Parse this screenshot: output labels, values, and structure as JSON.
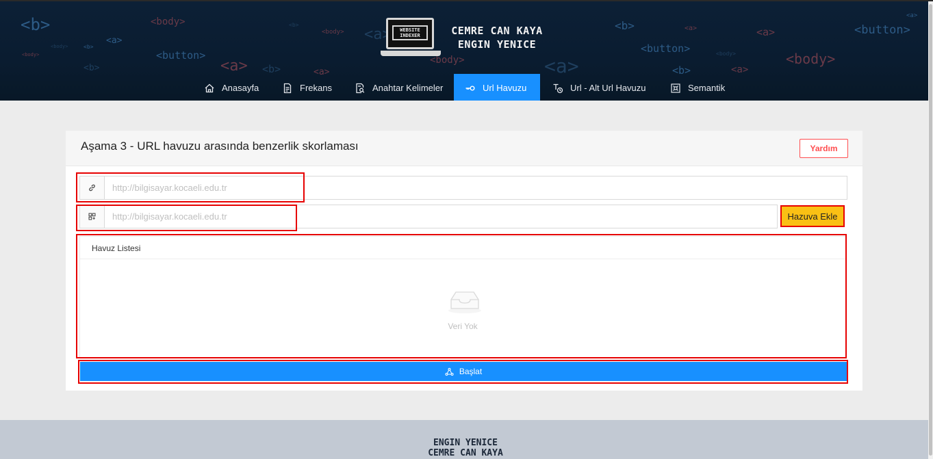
{
  "header": {
    "logo_lines": [
      "WEBSITE",
      "INDEXER"
    ],
    "name_line1": "CEMRE CAN KAYA",
    "name_line2": "ENGIN YENICE",
    "background_tags": [
      "<b>",
      "<body>",
      "<a>",
      "<button>",
      "<b>",
      "<body>",
      "<a>",
      "<b>",
      "<body>",
      "<a>",
      "<b>",
      "<a>",
      "<body>",
      "<a>",
      "<b>",
      "<button>",
      "<a>",
      "<body>",
      "<button>",
      "<b>",
      "<a>",
      "<b>",
      "<a>",
      "<a>",
      "<body>",
      "<body>"
    ]
  },
  "nav": {
    "items": [
      {
        "label": "Anasayfa",
        "icon": "home-icon"
      },
      {
        "label": "Frekans",
        "icon": "file-icon"
      },
      {
        "label": "Anahtar Kelimeler",
        "icon": "file-search-icon"
      },
      {
        "label": "Url Havuzu",
        "icon": "key-icon",
        "active": true
      },
      {
        "label": "Url - Alt Url Havuzu",
        "icon": "translate-icon"
      },
      {
        "label": "Semantik",
        "icon": "command-icon"
      }
    ],
    "accent_color": "#1890ff"
  },
  "card": {
    "title": "Aşama 3 - URL havuzu arasında benzerlik skorlaması",
    "help_label": "Yardım",
    "url_input": {
      "placeholder": "http://bilgisayar.kocaeli.edu.tr",
      "value": "",
      "icon": "link-icon"
    },
    "pool_input": {
      "placeholder": "http://bilgisayar.kocaeli.edu.tr",
      "value": "",
      "icon": "appstore-add-icon"
    },
    "add_label": "Hazuva Ekle",
    "pool": {
      "header": "Havuz Listesi",
      "empty_text": "Veri Yok",
      "icon": "inbox-icon"
    },
    "start_label": "Başlat",
    "start_icon": "deployment-icon"
  },
  "footer": {
    "line1": "ENGIN YENICE",
    "line2": "CEMRE CAN KAYA"
  },
  "colors": {
    "header_bg": "#0a1c30",
    "primary": "#1890ff",
    "warning": "#fac014",
    "danger": "#ff4d4f",
    "annotation": "#e60000"
  }
}
